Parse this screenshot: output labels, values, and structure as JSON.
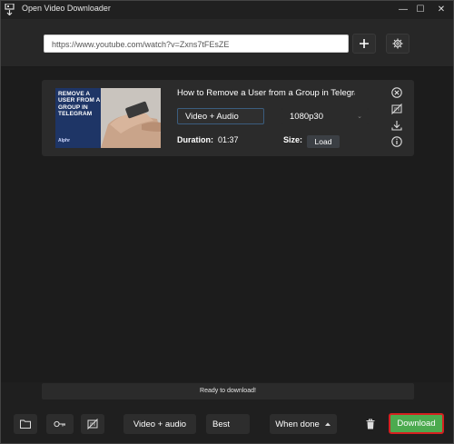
{
  "window": {
    "title": "Open Video Downloader",
    "minimize": "—",
    "maximize": "☐",
    "close": "✕"
  },
  "toolbar": {
    "url_value": "https://www.youtube.com/watch?v=Zxns7tFEsZE",
    "add_icon": "plus-icon",
    "settings_icon": "gear-icon"
  },
  "video": {
    "title": "How to Remove a User from a Group in Telegra",
    "thumbnail_text": "REMOVE A USER FROM A GROUP IN TELEGRAM",
    "thumbnail_brand": "Alphr",
    "format": "Video + Audio",
    "quality": "1080p30",
    "duration_label": "Duration:",
    "duration_value": "01:37",
    "size_label": "Size:",
    "load_label": "Load"
  },
  "status": {
    "text": "Ready to download!"
  },
  "bottom": {
    "format": "Video + audio",
    "quality": "Best",
    "when_done": "When done",
    "download": "Download"
  },
  "colors": {
    "accent_green": "#4caa4f",
    "highlight_red": "#d42020",
    "focus_blue": "#3b5d7e"
  }
}
